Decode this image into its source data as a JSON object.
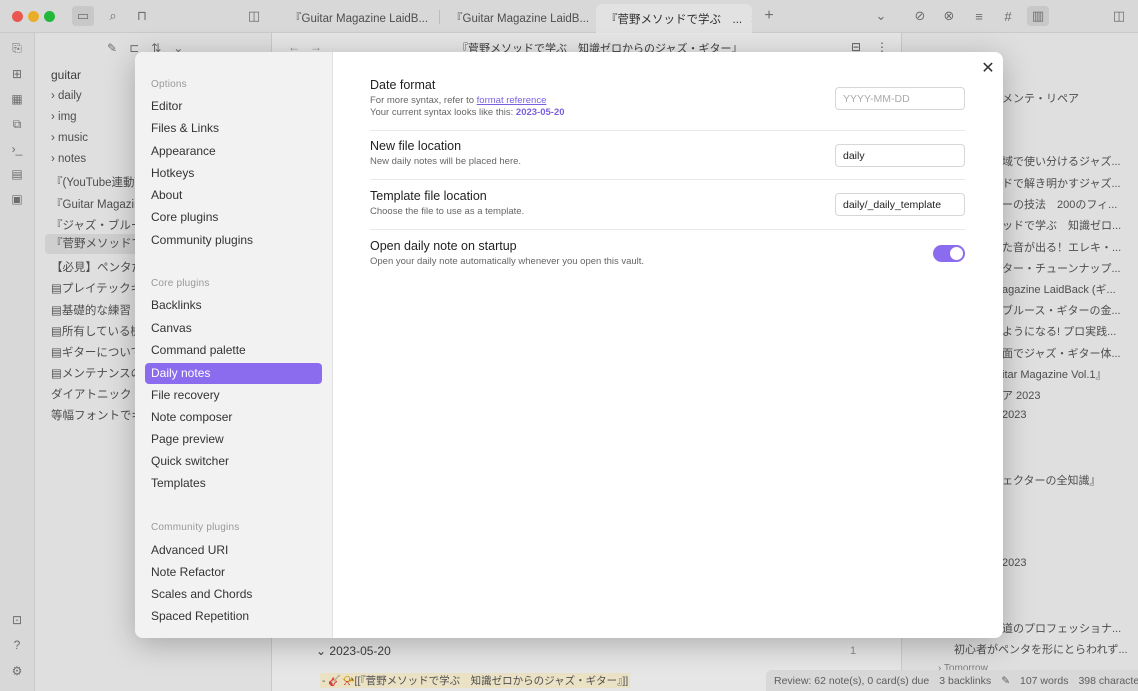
{
  "tabs": [
    {
      "label": "『Guitar Magazine LaidB..."
    },
    {
      "label": "『Guitar Magazine LaidB..."
    },
    {
      "label": "『菅野メソッドで学ぶ　..."
    }
  ],
  "explorer": {
    "vault": "guitar",
    "items": [
      {
        "label": "›  daily"
      },
      {
        "label": "›  img"
      },
      {
        "label": "›  music"
      },
      {
        "label": "›  notes"
      },
      {
        "label": "『(YouTube連動) ."
      },
      {
        "label": "『Guitar Magazine"
      },
      {
        "label": "『ジャズ・ブルース"
      },
      {
        "label": "『菅野メソッドで"
      },
      {
        "label": "【必見】ペンタだ"
      },
      {
        "label": "▤プレイテックギ"
      },
      {
        "label": "▤基礎的な練習"
      },
      {
        "label": "▤所有している機"
      },
      {
        "label": "▤ギターについて"
      },
      {
        "label": "▤メンテナンスの"
      },
      {
        "label": "ダイアトニック・"
      },
      {
        "label": "等幅フォントでギ"
      }
    ]
  },
  "editor": {
    "title": "『菅野メソッドで学ぶ　知識ゼロからのジャズ・ギター』",
    "bottom_date": "2023-05-20",
    "bottom_count": "1",
    "bottom_line": "- 🎸📯[[『菅野メソッドで学ぶ　知識ゼロからのジャズ・ギター』]]"
  },
  "right_sidebar": {
    "items": [
      {
        "label": "メンテ・リペア"
      },
      {
        "label": "域で使い分けるジャズ..."
      },
      {
        "label": "ドで解き明かすジャズ..."
      },
      {
        "label": "ーの技法　200のフィ..."
      },
      {
        "label": "ッドで学ぶ　知識ゼロ..."
      },
      {
        "label": "た音が出る！エレキ・..."
      },
      {
        "label": "ター・チューンナップ..."
      },
      {
        "label": "agazine LaidBack (ギ..."
      },
      {
        "label": "ブルース・ギターの金..."
      },
      {
        "label": "ようになる! プロ実践..."
      },
      {
        "label": "面でジャズ・ギター体..."
      },
      {
        "label": "itar Magazine Vol.1』"
      },
      {
        "label": "ア 2023"
      },
      {
        "label": "2023"
      },
      {
        "label": "ェクターの全知識』"
      },
      {
        "label": "2023"
      },
      {
        "label": "道のプロフェッショナ..."
      },
      {
        "label": "初心者がペンタを形にとらわれず..."
      },
      {
        "label": "›  Tomorrow"
      }
    ]
  },
  "statusbar": {
    "review": "Review: 62 note(s), 0 card(s) due",
    "backlinks": "3 backlinks",
    "words": "107 words",
    "chars": "398 characters"
  },
  "settings_modal": {
    "nav_heading_options": "Options",
    "nav_options": [
      "Editor",
      "Files & Links",
      "Appearance",
      "Hotkeys",
      "About",
      "Core plugins",
      "Community plugins"
    ],
    "nav_heading_core": "Core plugins",
    "nav_core": [
      "Backlinks",
      "Canvas",
      "Command palette",
      "Daily notes",
      "File recovery",
      "Note composer",
      "Page preview",
      "Quick switcher",
      "Templates"
    ],
    "nav_heading_community": "Community plugins",
    "nav_community": [
      "Advanced URI",
      "Note Refactor",
      "Scales and Chords",
      "Spaced Repetition"
    ],
    "active_item": "Daily notes",
    "close_glyph": "✕",
    "date_format": {
      "name": "Date format",
      "desc_prefix": "For more syntax, refer to ",
      "desc_link": "format reference",
      "desc_current_prefix": "Your current syntax looks like this: ",
      "desc_current_value": "2023-05-20",
      "placeholder": "YYYY-MM-DD"
    },
    "new_file_location": {
      "name": "New file location",
      "desc": "New daily notes will be placed here.",
      "value": "daily"
    },
    "template_file_location": {
      "name": "Template file location",
      "desc": "Choose the file to use as a template.",
      "value": "daily/_daily_template"
    },
    "open_on_startup": {
      "name": "Open daily note on startup",
      "desc": "Open your daily note automatically whenever you open this vault.",
      "enabled": true
    }
  },
  "colors": {
    "accent": "#8b6cef"
  }
}
